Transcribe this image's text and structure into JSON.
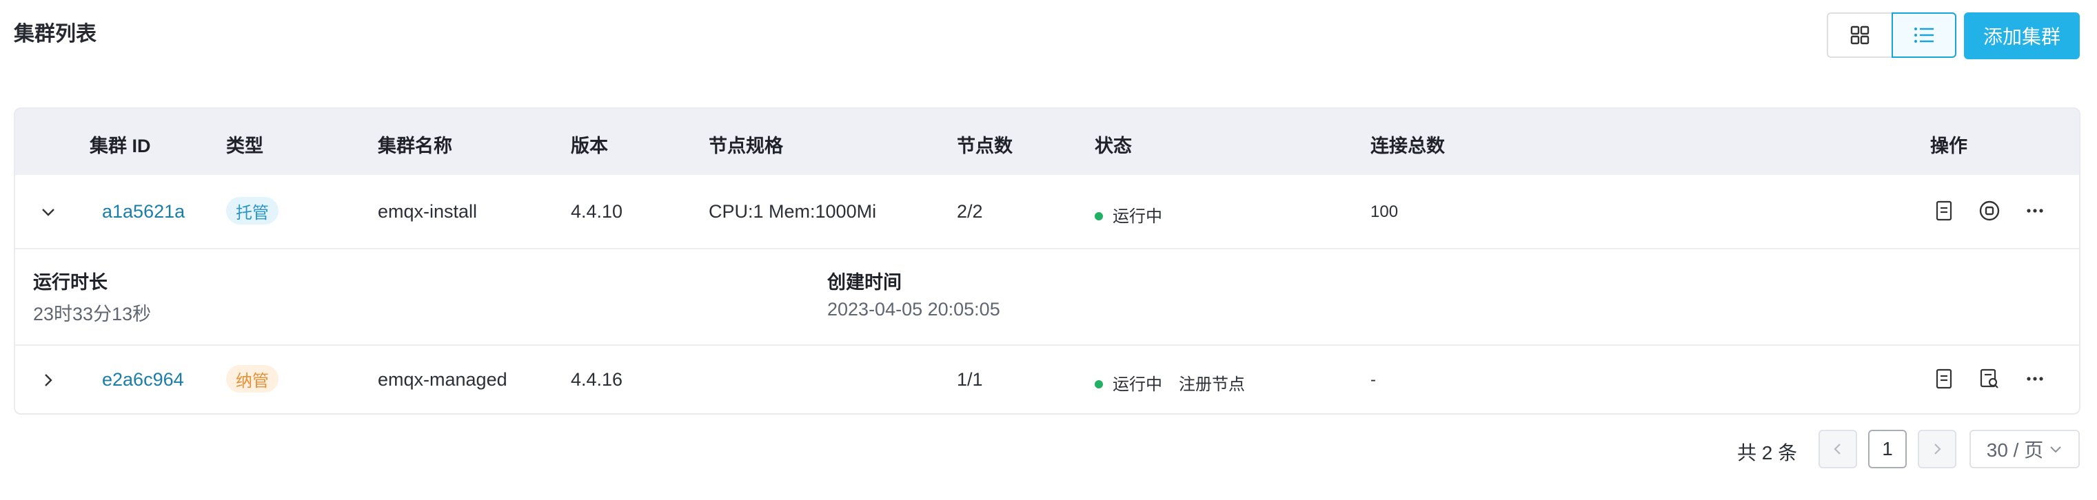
{
  "header": {
    "title": "集群列表",
    "add_button": "添加集群"
  },
  "icons": {
    "grid_view": "grid-icon",
    "list_view": "list-icon"
  },
  "table": {
    "columns": [
      "集群 ID",
      "类型",
      "集群名称",
      "版本",
      "节点规格",
      "节点数",
      "状态",
      "连接总数",
      "操作"
    ],
    "rows": [
      {
        "id": "a1a5621a",
        "type": "托管",
        "name": "emqx-install",
        "version": "4.4.10",
        "spec": "CPU:1 Mem:1000Mi",
        "nodes": "2/2",
        "status": "运行中",
        "connections": "100",
        "expanded": true,
        "details": {
          "uptime_label": "运行时长",
          "uptime": "23时33分13秒",
          "created_label": "创建时间",
          "created": "2023-04-05 20:05:05"
        }
      },
      {
        "id": "e2a6c964",
        "type": "纳管",
        "name": "emqx-managed",
        "version": "4.4.16",
        "spec": "",
        "nodes": "1/1",
        "status": "运行中",
        "status_link": "注册节点",
        "connections": "-",
        "expanded": false
      }
    ]
  },
  "pagination": {
    "total_text": "共 2 条",
    "current_page": "1",
    "page_size": "30 / 页"
  },
  "colors": {
    "accent": "#22b2e8",
    "link": "#1b7ea8",
    "running": "#21b064",
    "header_bg": "#eef0f6"
  }
}
